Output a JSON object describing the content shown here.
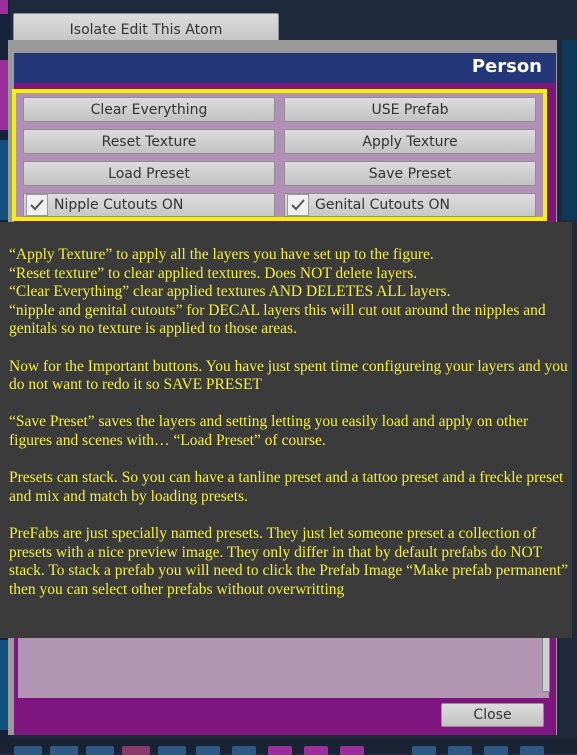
{
  "isolate_button": "Isolate Edit This Atom",
  "panel": {
    "title": "Person",
    "buttons": {
      "clear_everything": "Clear Everything",
      "use_prefab": "USE Prefab",
      "reset_texture": "Reset Texture",
      "apply_texture": "Apply Texture",
      "load_preset": "Load Preset",
      "save_preset": "Save Preset",
      "close": "Close"
    },
    "checkboxes": {
      "nipple": {
        "label": "Nipple Cutouts ON",
        "checked": true
      },
      "genital": {
        "label": "Genital Cutouts ON",
        "checked": true
      }
    }
  },
  "tooltip": {
    "lines": [
      "“Apply Texture” to apply all the layers you have set up to the figure.",
      "“Reset texture” to clear applied textures. Does NOT delete layers.",
      "“Clear Everything” clear applied textures AND DELETES ALL layers.",
      "“nipple and genital cutouts”  for DECAL layers this will cut out around the nipples and genitals so no texture is applied to those areas."
    ],
    "important": "Now for the Important buttons. You have just spent time configureing your layers and you do not want to redo it so SAVE PRESET",
    "save_preset": "“Save Preset”  saves the layers and setting letting you easily load and apply on other figures and scenes with… “Load Preset” of course.",
    "stack": "Presets can stack.  So you can have a tanline preset and a tattoo preset and a freckle preset and  mix and match by loading presets.",
    "prefabs": "PreFabs are just specially named presets. They just let someone preset a collection of presets with a nice preview image. They only differ in that by default prefabs do NOT stack. To stack a prefab you will need to click the Prefab Image “Make prefab permanent” then you can select other prefabs without overwritting"
  },
  "colors": {
    "accent": "#f3f300",
    "panel": "#7f167f",
    "header": "#243779",
    "tooltip_text": "#f4f03a"
  }
}
